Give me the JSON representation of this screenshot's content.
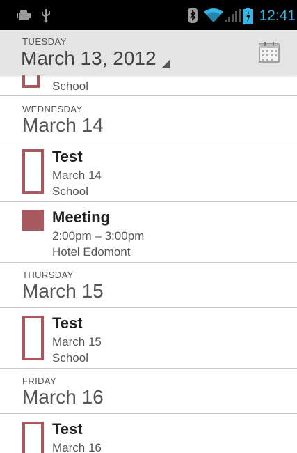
{
  "status_bar": {
    "time": "12:41",
    "icons": [
      "android-debug-icon",
      "usb-icon",
      "bluetooth-icon",
      "wifi-icon",
      "signal-icon",
      "battery-charging-icon"
    ]
  },
  "header": {
    "day_of_week": "TUESDAY",
    "date": "March 13, 2012",
    "calendar_icon": "calendar-icon"
  },
  "agenda": {
    "partial_event": {
      "location": "School"
    },
    "days": [
      {
        "day_of_week": "WEDNESDAY",
        "date": "March 14",
        "events": [
          {
            "title": "Test",
            "time": "March 14",
            "location": "School",
            "style": "outline"
          },
          {
            "title": "Meeting",
            "time": "2:00pm – 3:00pm",
            "location": "Hotel Edomont",
            "style": "solid"
          }
        ]
      },
      {
        "day_of_week": "THURSDAY",
        "date": "March 15",
        "events": [
          {
            "title": "Test",
            "time": "March 15",
            "location": "School",
            "style": "outline"
          }
        ]
      },
      {
        "day_of_week": "FRIDAY",
        "date": "March 16",
        "events": [
          {
            "title": "Test",
            "time": "March 16",
            "style": "outline"
          }
        ]
      }
    ]
  },
  "colors": {
    "event_color": "#a65a60",
    "status_time": "#33b5e5",
    "header_bg": "#e4e4e4"
  }
}
